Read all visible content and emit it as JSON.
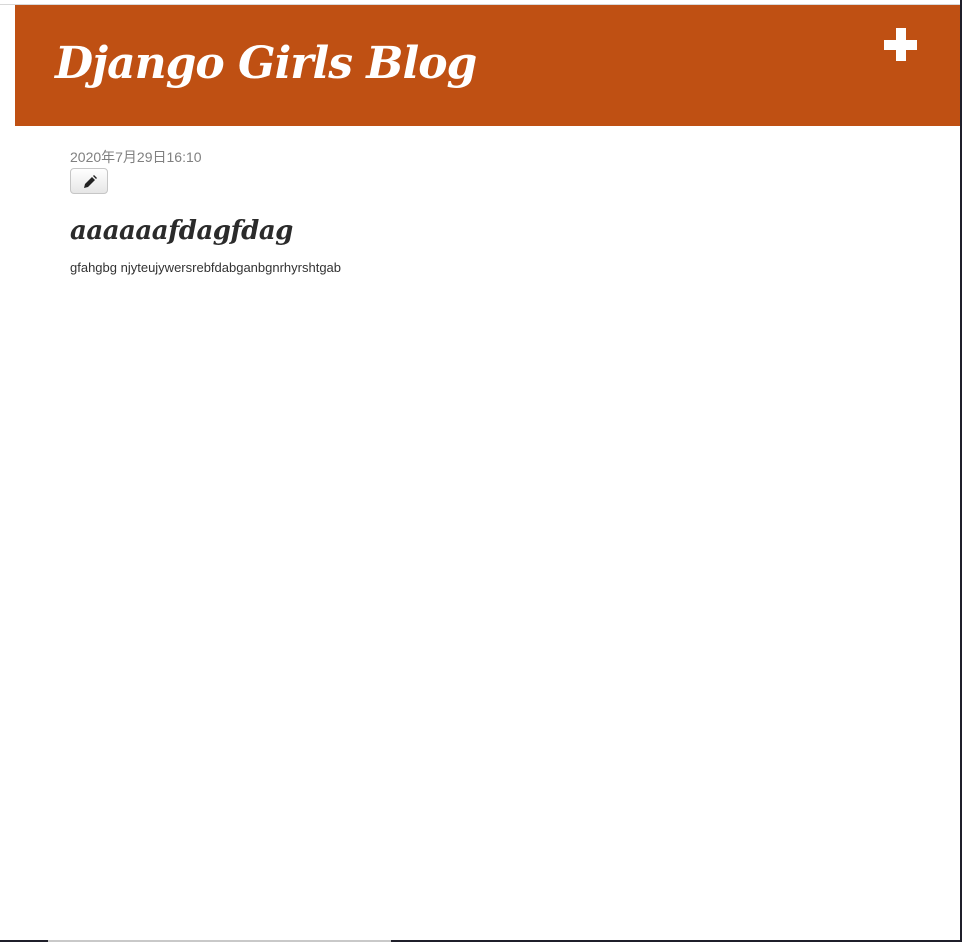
{
  "header": {
    "title": "Django Girls Blog",
    "add_icon": "plus-icon",
    "color": "#bf5013"
  },
  "post": {
    "date": "2020年7月29日16:10",
    "edit_icon": "pencil-icon",
    "title": "aaaaaafdagfdag",
    "body": "gfahgbg njyteujywersrebfdabganbgnrhyrshtgab"
  }
}
